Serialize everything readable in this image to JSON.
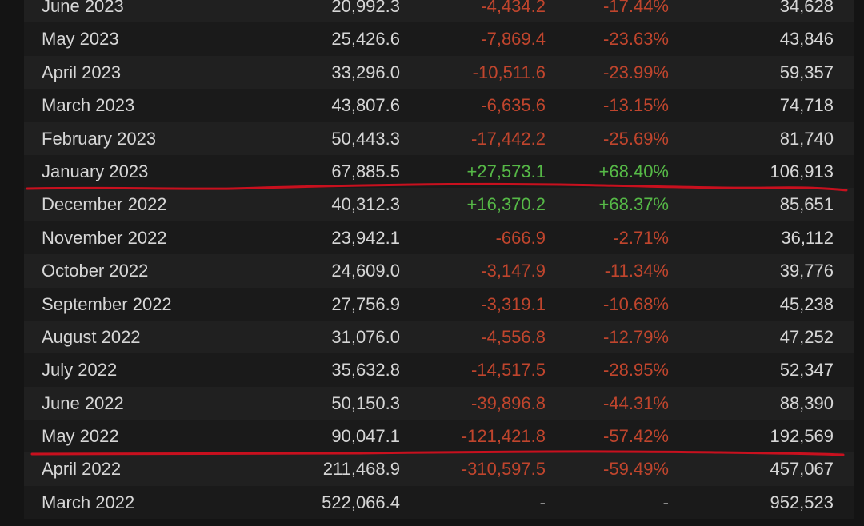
{
  "table": {
    "rows": [
      {
        "month": "June 2023",
        "avg": "20,992.3",
        "gain": "-4,434.2",
        "pct": "-17.44%",
        "peak": "34,628",
        "sign": "neg"
      },
      {
        "month": "May 2023",
        "avg": "25,426.6",
        "gain": "-7,869.4",
        "pct": "-23.63%",
        "peak": "43,846",
        "sign": "neg"
      },
      {
        "month": "April 2023",
        "avg": "33,296.0",
        "gain": "-10,511.6",
        "pct": "-23.99%",
        "peak": "59,357",
        "sign": "neg"
      },
      {
        "month": "March 2023",
        "avg": "43,807.6",
        "gain": "-6,635.6",
        "pct": "-13.15%",
        "peak": "74,718",
        "sign": "neg"
      },
      {
        "month": "February 2023",
        "avg": "50,443.3",
        "gain": "-17,442.2",
        "pct": "-25.69%",
        "peak": "81,740",
        "sign": "neg"
      },
      {
        "month": "January 2023",
        "avg": "67,885.5",
        "gain": "+27,573.1",
        "pct": "+68.40%",
        "peak": "106,913",
        "sign": "pos"
      },
      {
        "month": "December 2022",
        "avg": "40,312.3",
        "gain": "+16,370.2",
        "pct": "+68.37%",
        "peak": "85,651",
        "sign": "pos"
      },
      {
        "month": "November 2022",
        "avg": "23,942.1",
        "gain": "-666.9",
        "pct": "-2.71%",
        "peak": "36,112",
        "sign": "neg"
      },
      {
        "month": "October 2022",
        "avg": "24,609.0",
        "gain": "-3,147.9",
        "pct": "-11.34%",
        "peak": "39,776",
        "sign": "neg"
      },
      {
        "month": "September 2022",
        "avg": "27,756.9",
        "gain": "-3,319.1",
        "pct": "-10.68%",
        "peak": "45,238",
        "sign": "neg"
      },
      {
        "month": "August 2022",
        "avg": "31,076.0",
        "gain": "-4,556.8",
        "pct": "-12.79%",
        "peak": "47,252",
        "sign": "neg"
      },
      {
        "month": "July 2022",
        "avg": "35,632.8",
        "gain": "-14,517.5",
        "pct": "-28.95%",
        "peak": "52,347",
        "sign": "neg"
      },
      {
        "month": "June 2022",
        "avg": "50,150.3",
        "gain": "-39,896.8",
        "pct": "-44.31%",
        "peak": "88,390",
        "sign": "neg"
      },
      {
        "month": "May 2022",
        "avg": "90,047.1",
        "gain": "-121,421.8",
        "pct": "-57.42%",
        "peak": "192,569",
        "sign": "neg"
      },
      {
        "month": "April 2022",
        "avg": "211,468.9",
        "gain": "-310,597.5",
        "pct": "-59.49%",
        "peak": "457,067",
        "sign": "neg"
      },
      {
        "month": "March 2022",
        "avg": "522,066.4",
        "gain": "-",
        "pct": "-",
        "peak": "952,523",
        "sign": "neutral"
      }
    ]
  },
  "colors": {
    "negative": "#c0452d",
    "positive": "#56b947",
    "annotation_line": "#c8101e"
  }
}
